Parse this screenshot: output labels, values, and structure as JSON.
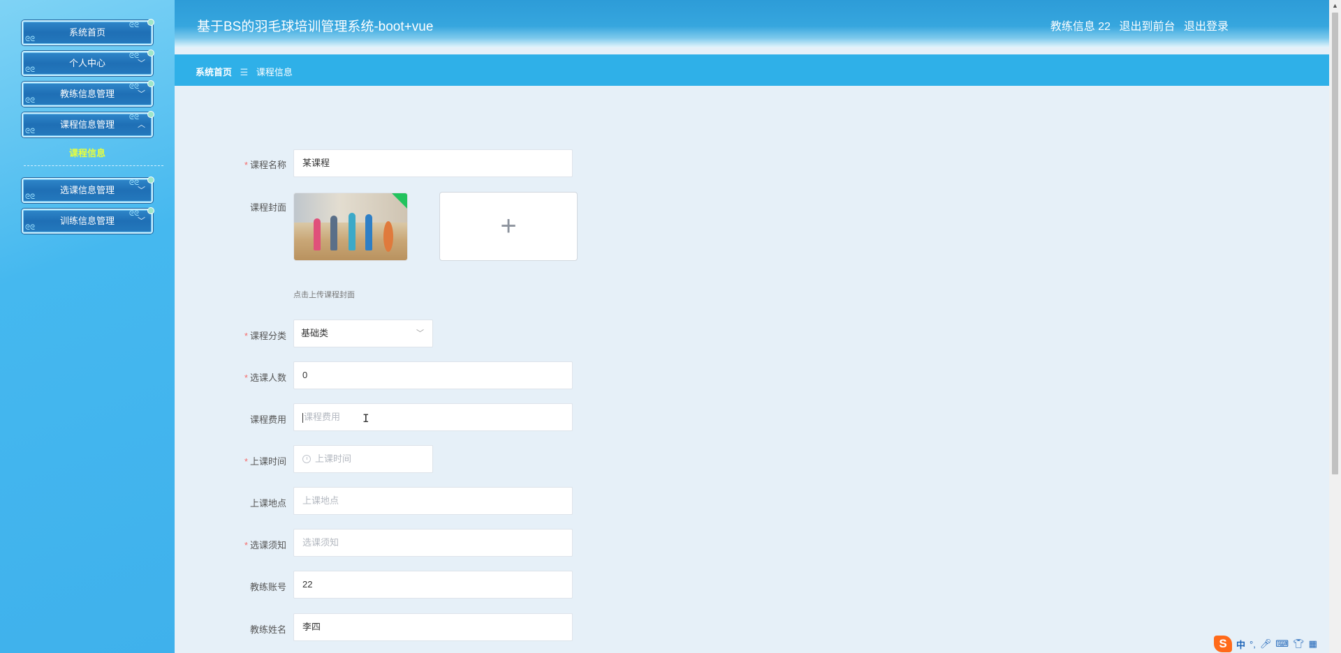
{
  "sidebar": {
    "items": [
      {
        "label": "系统首页",
        "has_children": false
      },
      {
        "label": "个人中心",
        "has_children": true
      },
      {
        "label": "教练信息管理",
        "has_children": true
      },
      {
        "label": "课程信息管理",
        "has_children": true
      },
      {
        "label": "选课信息管理",
        "has_children": true
      },
      {
        "label": "训练信息管理",
        "has_children": true
      }
    ],
    "active_submenu": "课程信息"
  },
  "header": {
    "title": "基于BS的羽毛球培训管理系统-boot+vue",
    "user_info": "教练信息 22",
    "front_link": "退出到前台",
    "logout": "退出登录"
  },
  "breadcrumb": {
    "home": "系统首页",
    "separator": "☰",
    "current": "课程信息"
  },
  "form": {
    "course_name": {
      "label": "课程名称",
      "required": true,
      "value": "某课程"
    },
    "cover": {
      "label": "课程封面",
      "hint": "点击上传课程封面",
      "upload_glyph": "+"
    },
    "category": {
      "label": "课程分类",
      "required": true,
      "value": "基础类"
    },
    "enrolled": {
      "label": "选课人数",
      "required": true,
      "value": "0"
    },
    "fee": {
      "label": "课程费用",
      "required": false,
      "placeholder": "课程费用"
    },
    "class_time": {
      "label": "上课时间",
      "required": true,
      "placeholder": "上课时间"
    },
    "location": {
      "label": "上课地点",
      "required": false,
      "placeholder": "上课地点"
    },
    "notice": {
      "label": "选课须知",
      "required": true,
      "placeholder": "选课须知"
    },
    "coach_account": {
      "label": "教练账号",
      "required": false,
      "value": "22"
    },
    "coach_name": {
      "label": "教练姓名",
      "required": false,
      "value": "李四"
    }
  },
  "ime": {
    "logo": "S",
    "mode": "中",
    "punct": "°,"
  },
  "colors": {
    "header": "#36a6de",
    "crumbbar": "#2fb0e8",
    "content_bg": "#e6f0f8",
    "active_submenu": "#e9ff3a",
    "required_mark": "#f56c6c"
  }
}
